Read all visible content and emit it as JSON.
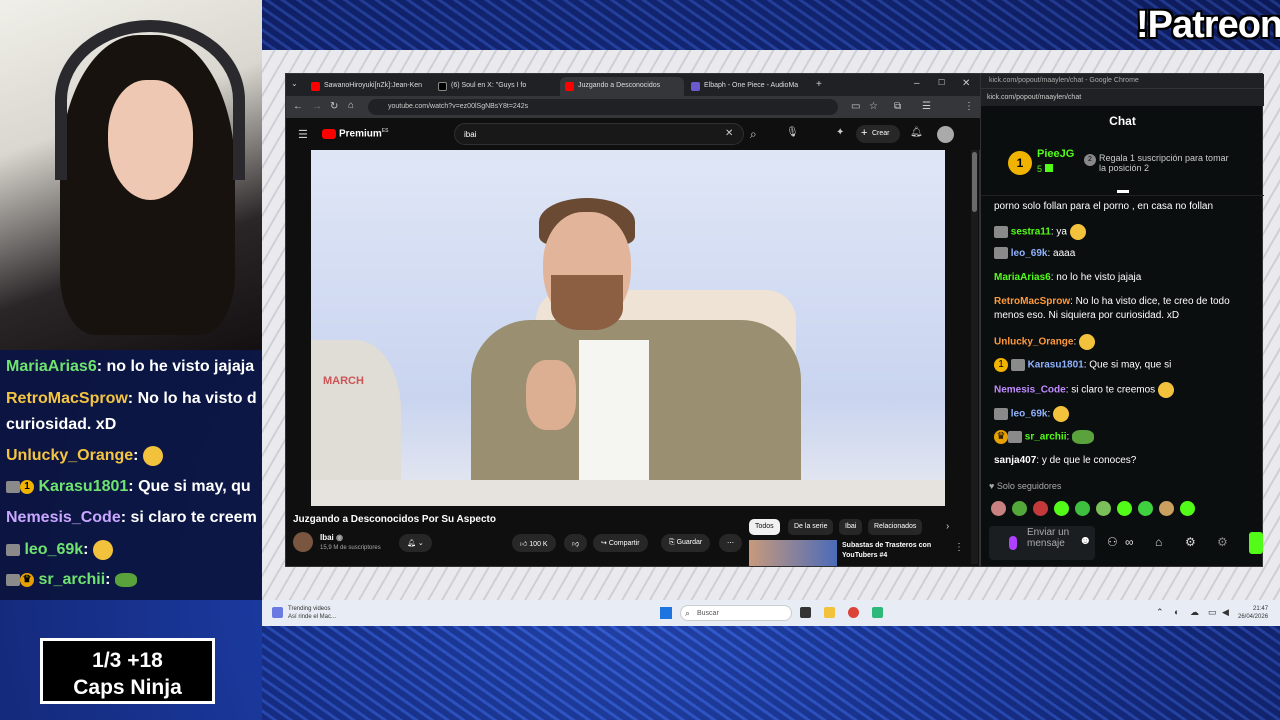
{
  "overlay": {
    "patreon": "!Patreon",
    "caps_ninja": {
      "line1": "1/3   +18",
      "line2": "Caps Ninja"
    },
    "stream_chat": [
      {
        "user": "MariaArias6",
        "color": "#6fe36f",
        "text": ": no lo he visto jajaja"
      },
      {
        "user": "RetroMacSprow",
        "color": "#f5c542",
        "text": ": No lo ha visto d"
      },
      {
        "user": "",
        "color": "#ffffff",
        "text": "curiosidad. xD"
      },
      {
        "user": "Unlucky_Orange",
        "color": "#f5c542",
        "text": ":"
      },
      {
        "user": "Karasu1801",
        "color": "#6fe36f",
        "text": ": Que si may, qu"
      },
      {
        "user": "Nemesis_Code",
        "color": "#c9a6ff",
        "text": ": si claro te creem"
      },
      {
        "user": "leo_69k",
        "color": "#6fe36f",
        "text": ":"
      },
      {
        "user": "sr_archii",
        "color": "#6fe36f",
        "text": ":"
      }
    ]
  },
  "browser": {
    "tabs": [
      {
        "label": "SawanoHiroyuki[nZk]:Jean-Ken",
        "color": "#ff0000"
      },
      {
        "label": "(6)  Soul  en X: \"Guys I fo",
        "color": "#ffffff"
      },
      {
        "label": "Juzgando a Desconocidos",
        "color": "#ff0000"
      },
      {
        "label": "Elbaph - One Piece - AudioMa",
        "color": "#6a5acd"
      }
    ],
    "url": "youtube.com/watch?v=ez00lSgNBsY8t=242s",
    "youtube": {
      "logo": "Premium",
      "region": "ES",
      "search_value": "ibai",
      "create_label": "Crear",
      "video_sign": "MARCH",
      "video_title": "Juzgando a Desconocidos Por Su Aspecto",
      "channel": "Ibai",
      "subscribers": "15,9 M de suscriptores",
      "likes": "100 K",
      "share_label": "Compartir",
      "save_label": "Guardar",
      "chips": [
        "Todos",
        "De la serie",
        "Ibai",
        "Relacionados"
      ],
      "rec_title": "Subastas de Trasteros con YouTubers #4"
    }
  },
  "kick": {
    "window_title": "kick.com/popout/maaylen/chat - Google Chrome",
    "url": "kick.com/popout/maaylen/chat",
    "header": "Chat",
    "pinned": {
      "rank": "1",
      "user": "PieeJG",
      "count": "5",
      "rank2": "2",
      "text": "Regala 1 suscripción para tomar la posición 2"
    },
    "messages": [
      {
        "user": "",
        "color": "#ffffff",
        "text": "porno solo follan para el porno , en casa no follan"
      },
      {
        "user": "sestra11",
        "color": "#53fc18",
        "text": ": ya"
      },
      {
        "user": "leo_69k",
        "color": "#8fb3ff",
        "text": ": aaaa"
      },
      {
        "user": "MariaArias6",
        "color": "#53fc18",
        "text": ": no lo he visto jajaja"
      },
      {
        "user": "RetroMacSprow",
        "color": "#ff9a3c",
        "text": ": No lo ha visto dice, te creo de todo menos eso. Ni siquiera por curiosidad. xD"
      },
      {
        "user": "Unlucky_Orange",
        "color": "#ff9a3c",
        "text": ":"
      },
      {
        "user": "Karasu1801",
        "color": "#8fb3ff",
        "text": ": Que si may, que si"
      },
      {
        "user": "Nemesis_Code",
        "color": "#c08bff",
        "text": ": si claro te creemos"
      },
      {
        "user": "leo_69k",
        "color": "#8fb3ff",
        "text": ":"
      },
      {
        "user": "sr_archii",
        "color": "#53fc18",
        "text": ":"
      },
      {
        "user": "sanja407",
        "color": "#ffffff",
        "text": ": y de que le conoces?"
      }
    ],
    "followers_only": "Solo seguidores",
    "input_placeholder": "Enviar un mensaje"
  },
  "taskbar": {
    "trending_line1": "Trending videos",
    "trending_line2": "Así rinde el Mac...",
    "search_label": "Buscar",
    "time": "21:47",
    "date": "26/04/2026"
  }
}
